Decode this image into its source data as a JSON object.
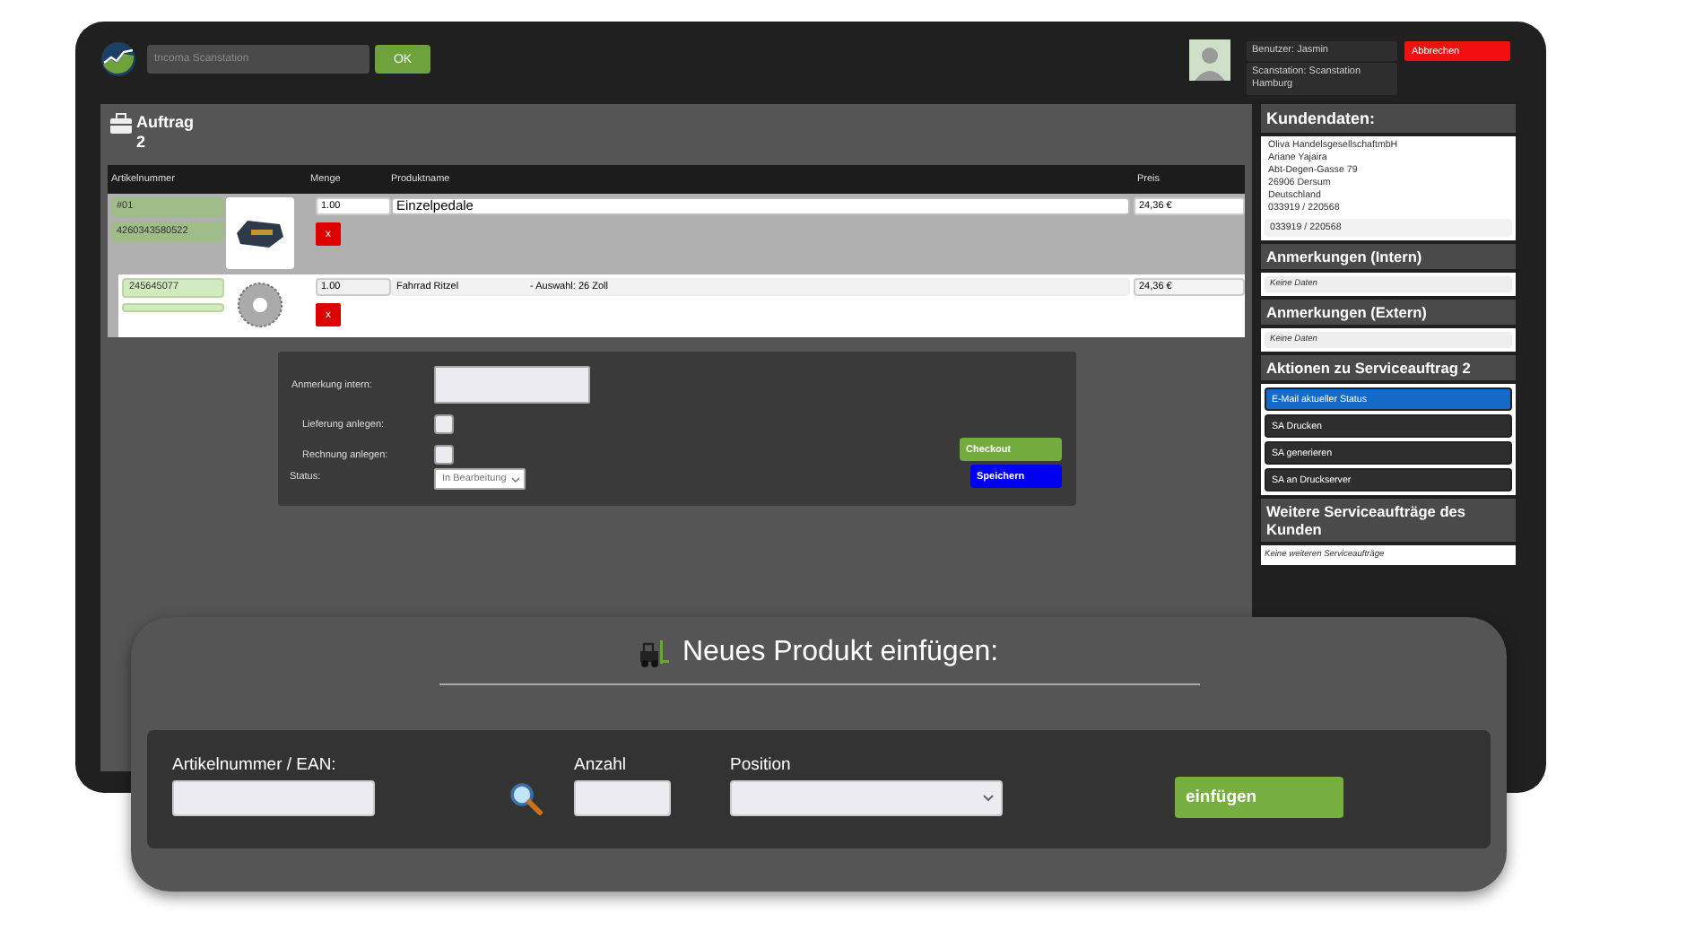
{
  "header": {
    "search": {
      "placeholder": "tricoma Scanstation"
    },
    "ok_button": "OK",
    "user": "Benutzer: Jasmin",
    "station": "Scanstation: Scanstation Hamburg",
    "cancel_button": "Abbrechen"
  },
  "order": {
    "title": "Auftrag",
    "number": "2",
    "columns": [
      "Artikelnummer",
      "Menge",
      "Produktname",
      "Preis"
    ],
    "rows": [
      {
        "selected": true,
        "position": "#01",
        "article_number": "4260343580522",
        "quantity": "1.00",
        "name": "Einzelpedale",
        "price": "24,36 €",
        "remove": "x",
        "children": [
          {
            "selected": false,
            "article_number": "245645077",
            "quantity": "1.00",
            "name": "Fahrrad Ritzel",
            "option": "- Auswahl: 26 Zoll",
            "price": "24,36 €",
            "remove": "x"
          }
        ]
      }
    ],
    "form": {
      "note_label": "Anmerkung intern:",
      "checkboxes": [
        {
          "label": "Lieferung anlegen:",
          "checked": false
        },
        {
          "label": "Rechnung anlegen:",
          "checked": false
        }
      ],
      "status_label": "Status:",
      "status_value": "In Bearbeitung",
      "buttons": [
        {
          "label": "Checkout",
          "kind": "checkout"
        },
        {
          "label": "Speichern",
          "kind": "save"
        }
      ]
    }
  },
  "sidebar": {
    "sections": [
      {
        "title": "Kundendaten:",
        "kind": "address",
        "lines": [
          "Oliva HandelsgesellschaftmbH",
          "Ariane Yajaira",
          "Abt-Degen-Gasse 79",
          "26906 Dersum",
          "Deutschland",
          "033919 / 220568"
        ],
        "phone": "033919 / 220568"
      },
      {
        "title": "Anmerkungen (Intern)",
        "kind": "note",
        "text": "Keine Daten"
      },
      {
        "title": "Anmerkungen (Extern)",
        "kind": "note",
        "text": "Keine Daten"
      },
      {
        "title": "Aktionen zu Serviceauftrag 2",
        "kind": "actions",
        "actions": [
          {
            "label": "E-Mail aktueller Status",
            "selected": true
          },
          {
            "label": "SA Drucken",
            "selected": false
          },
          {
            "label": "SA generieren",
            "selected": false
          },
          {
            "label": "SA an Druckserver",
            "selected": false
          }
        ]
      },
      {
        "title": "Weitere Serviceaufträge des Kunden",
        "kind": "plain",
        "text": "Keine weiteren Serviceaufträge"
      }
    ]
  },
  "dialog": {
    "title": "Neues Produkt einfügen:",
    "fields": [
      {
        "label": "Artikelnummer / EAN:",
        "kind": "text"
      },
      {
        "label": "Anzahl",
        "kind": "number"
      },
      {
        "label": "Position",
        "kind": "select"
      }
    ],
    "submit": "einfügen"
  }
}
